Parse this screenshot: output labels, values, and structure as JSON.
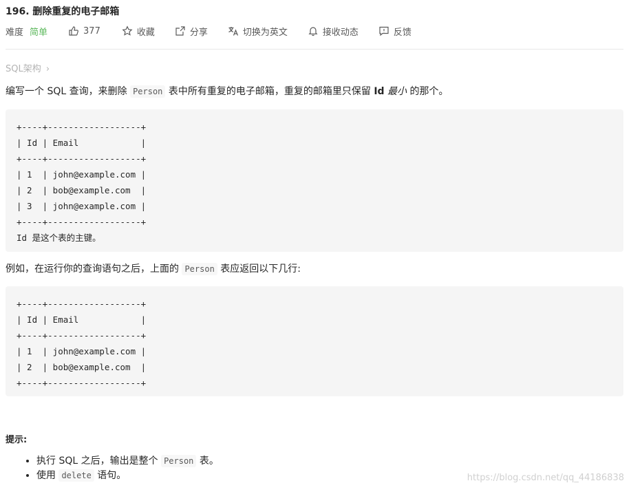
{
  "problem": {
    "title": "196. 删除重复的电子邮箱"
  },
  "meta": {
    "difficulty_label": "难度",
    "difficulty_value": "简单",
    "likes": "377",
    "favorite": "收藏",
    "share": "分享",
    "switch_lang": "切换为英文",
    "subscribe": "接收动态",
    "feedback": "反馈"
  },
  "breadcrumb": {
    "label": "SQL架构",
    "arrow": "›"
  },
  "description": {
    "intro_1": "编写一个 SQL 查询，来删除 ",
    "intro_code": "Person",
    "intro_2": " 表中所有重复的电子邮箱，重复的邮箱里只保留 ",
    "intro_bold": "Id",
    "intro_em": " 最小",
    "intro_3": " 的那个。",
    "table1": "+----+------------------+\n| Id | Email            |\n+----+------------------+\n| 1  | john@example.com |\n| 2  | bob@example.com  |\n| 3  | john@example.com |\n+----+------------------+\nId 是这个表的主键。",
    "example_1": "例如，在运行你的查询语句之后，上面的 ",
    "example_code": "Person",
    "example_2": " 表应返回以下几行:",
    "table2": "+----+------------------+\n| Id | Email            |\n+----+------------------+\n| 1  | john@example.com |\n| 2  | bob@example.com  |\n+----+------------------+"
  },
  "hints": {
    "title": "提示:",
    "item1_a": "执行 SQL 之后，输出是整个 ",
    "item1_code": "Person",
    "item1_b": " 表。",
    "item2_a": "使用 ",
    "item2_code": "delete",
    "item2_b": " 语句。"
  },
  "watermark": "https://blog.csdn.net/qq_44186838",
  "colors": {
    "easy": "#5cb85c",
    "code_bg": "#f5f5f5",
    "muted": "#b3b3b3"
  }
}
